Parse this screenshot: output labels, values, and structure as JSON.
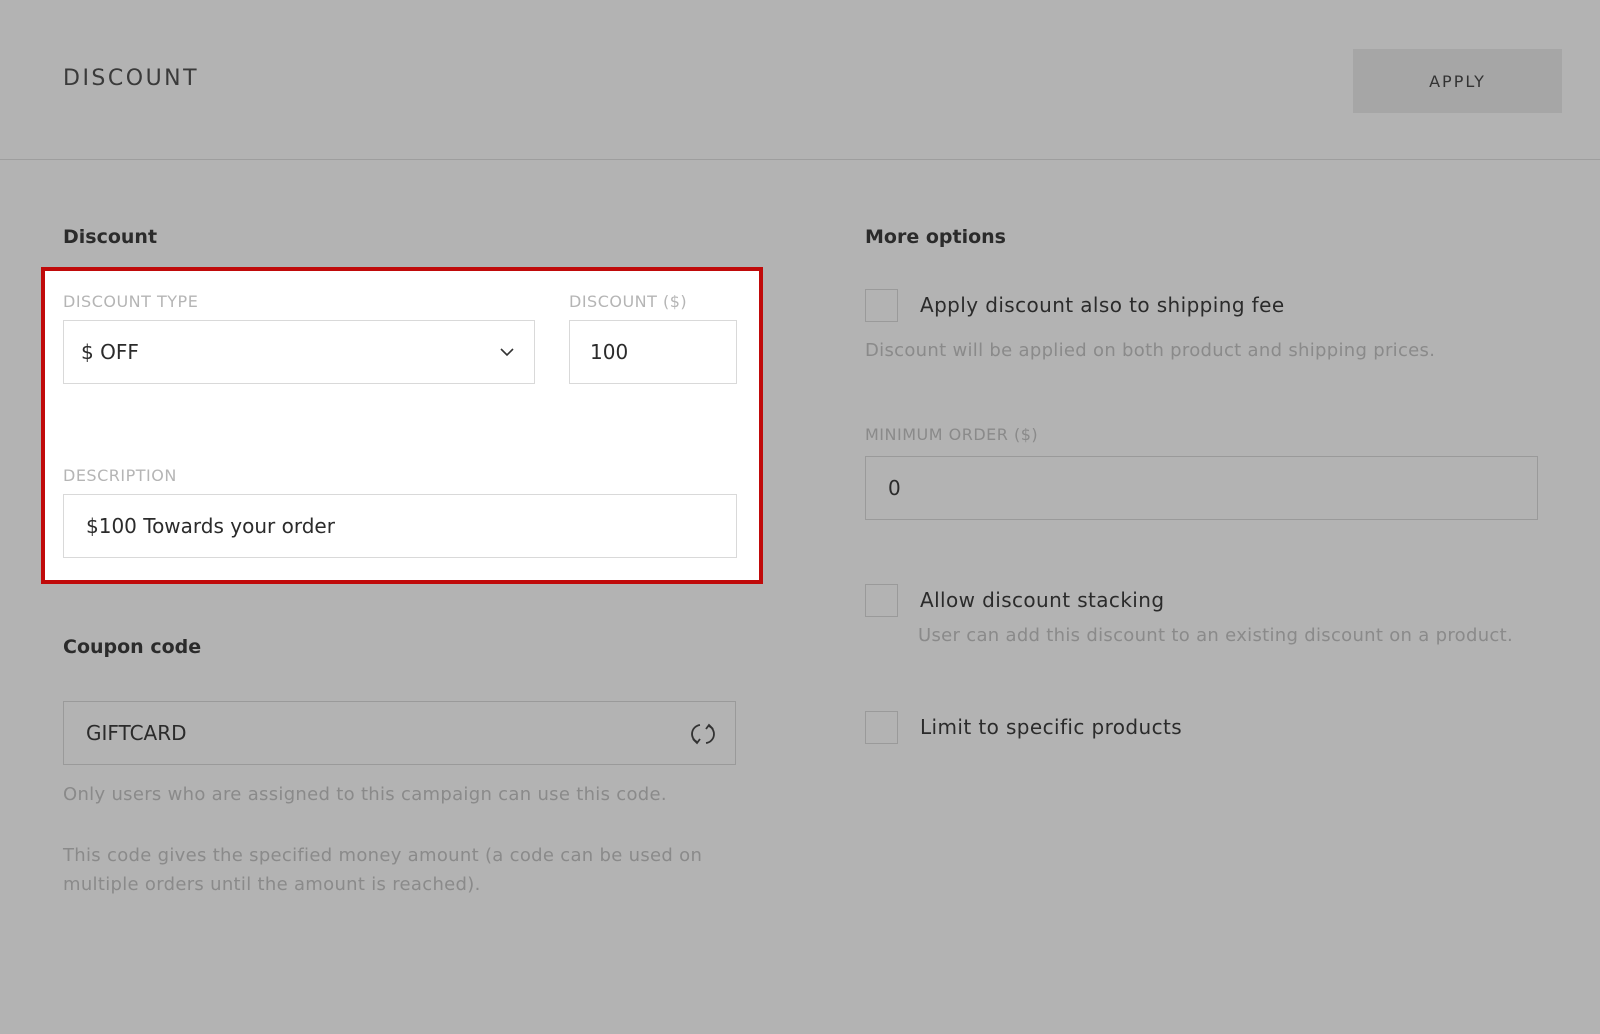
{
  "header": {
    "title": "DISCOUNT",
    "apply_label": "APPLY"
  },
  "discount_section": {
    "title": "Discount",
    "type_label": "DISCOUNT TYPE",
    "type_value": "$ OFF",
    "amount_label": "DISCOUNT ($)",
    "amount_value": "100",
    "description_label": "DESCRIPTION",
    "description_value": "$100 Towards your order"
  },
  "coupon_section": {
    "title": "Coupon code",
    "code_value": "GIFTCARD",
    "help_1": "Only users who are assigned to this campaign can use this code.",
    "help_2_line_1": "This code gives the specified money amount (a code can be used on",
    "help_2_line_2": "multiple orders until the amount is reached)."
  },
  "more_options": {
    "title": "More options",
    "shipping_label": "Apply discount also to shipping fee",
    "shipping_help": "Discount will be applied on both product and shipping prices.",
    "min_order_label": "MINIMUM ORDER ($)",
    "min_order_value": "0",
    "stacking_label": "Allow discount stacking",
    "stacking_help": "User can add this discount to an existing discount on a product.",
    "limit_label": "Limit to specific products"
  },
  "colors": {
    "highlight_border": "#c00a0a",
    "overlay": "#b3b3b3"
  }
}
